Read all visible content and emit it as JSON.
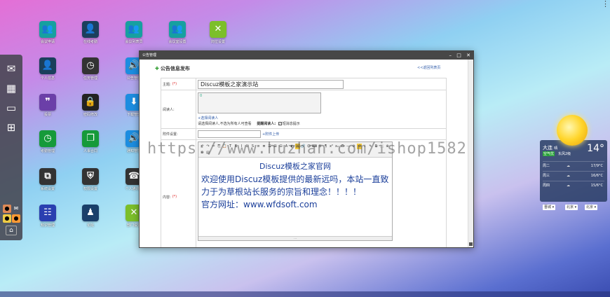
{
  "colors": {
    "window_title_bg": "#474747",
    "accent_link": "#2d5aa8",
    "required": "#dd2222",
    "editor_text": "#1b3f9a"
  },
  "desktop_icons": [
    {
      "label": "会议申请",
      "color": "#16a0a0",
      "glyph": "👥",
      "icon": "people-icon"
    },
    {
      "label": "在线考勤",
      "color": "#1b3f5c",
      "glyph": "👤",
      "icon": "user-icon"
    },
    {
      "label": "会议列表员",
      "color": "#16a0a0",
      "glyph": "👥",
      "icon": "people-icon"
    },
    {
      "label": "会议室设置",
      "color": "#16a0a0",
      "glyph": "👥",
      "icon": "people-icon"
    },
    {
      "label": "岗位设置",
      "color": "#7cbf2a",
      "glyph": "✕",
      "icon": "xbox-icon"
    },
    {
      "label": "个人信息",
      "color": "#1b3f5c",
      "glyph": "👤",
      "icon": "user-icon"
    },
    {
      "label": "任务管理",
      "color": "#333333",
      "glyph": "◷",
      "icon": "clock-icon"
    },
    {
      "label": "公告管理",
      "color": "#1c8de0",
      "glyph": "🔊",
      "icon": "speaker-icon"
    },
    {
      "label": "投票",
      "color": "#6b3fa8",
      "glyph": "❞",
      "icon": "quote-icon"
    },
    {
      "label": "密码修改",
      "color": "#222222",
      "glyph": "🔒",
      "icon": "lock-icon"
    },
    {
      "label": "下载管理",
      "color": "#1c8de0",
      "glyph": "⬇",
      "icon": "download-icon"
    },
    {
      "label": "考勤管理",
      "color": "#169a3a",
      "glyph": "◷",
      "icon": "clock-icon"
    },
    {
      "label": "人事合同",
      "color": "#169a3a",
      "glyph": "❐",
      "icon": "documents-icon"
    },
    {
      "label": "通知管理",
      "color": "#1c8de0",
      "glyph": "🔊",
      "icon": "speaker-icon"
    },
    {
      "label": "系统设置",
      "color": "#333333",
      "glyph": "⧉",
      "icon": "settings-icon"
    },
    {
      "label": "权限设置",
      "color": "#333333",
      "glyph": "⛨",
      "icon": "shield-icon"
    },
    {
      "label": "个人通讯录",
      "color": "#333333",
      "glyph": "☎",
      "icon": "contacts-icon"
    },
    {
      "label": "知识管理",
      "color": "#2a3fb0",
      "glyph": "☷",
      "icon": "knowledge-icon"
    },
    {
      "label": "论坛",
      "color": "#1a3f6a",
      "glyph": "♟",
      "icon": "forum-icon"
    },
    {
      "label": "部门设置",
      "color": "#7cbf2a",
      "glyph": "✕",
      "icon": "xbox-icon"
    }
  ],
  "window": {
    "title": "公告管理",
    "form_heading": "公告信息发布",
    "back_link": "<<返回列表页",
    "fields": {
      "title_label": "主题:",
      "title_required": "(*)",
      "title_value": "Discuz模板之家演示站",
      "reader_label": "阅读人:",
      "reader_box_value": "0",
      "reader_link": "+选择阅读人",
      "reader_note": "请选择阅读人,不选为所有人可查看",
      "remind_label": "提醒阅读人:",
      "remind_option": "短消息提示",
      "attach_label": "附件设置:",
      "attach_link": "+附件上传",
      "content_label": "内容:",
      "content_required": "(*)"
    },
    "editor": {
      "line1": "Discuz模板之家官网",
      "line2": "欢迎使用Discuz模板提供的最新远吗，本站一直致",
      "line3": "力于为草根站长服务的宗旨和理念！！！！",
      "line4_prefix": "官方网址：",
      "line4_url": "www.wfdsoft.com"
    }
  },
  "watermark": "https://www.huzhan.com/ishop1582",
  "weather": {
    "city": "大连",
    "condition": "晴",
    "air_quality": "空气优",
    "wind": "东风2级",
    "temperature": "14°",
    "forecast": [
      {
        "day": "周二",
        "temp": "17/9°C"
      },
      {
        "day": "周三",
        "temp": "16/6°C"
      },
      {
        "day": "周四",
        "temp": "15/6°C"
      }
    ],
    "selects": [
      "晋城 ▾",
      "北京 ▾",
      "北京 ▾"
    ]
  }
}
